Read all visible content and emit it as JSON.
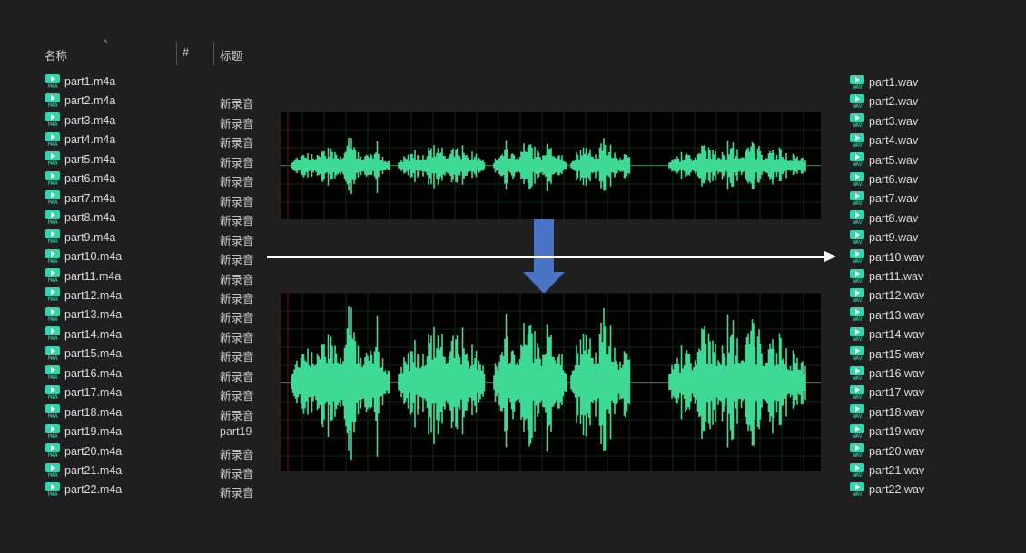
{
  "header": {
    "name_col": "名称",
    "num_col": "#",
    "title_col": "标题",
    "sort_glyph": "^"
  },
  "left_files": [
    {
      "name": "part1.m4a",
      "title": ""
    },
    {
      "name": "part2.m4a",
      "title": "新录音"
    },
    {
      "name": "part3.m4a",
      "title": "新录音"
    },
    {
      "name": "part4.m4a",
      "title": "新录音"
    },
    {
      "name": "part5.m4a",
      "title": "新录音"
    },
    {
      "name": "part6.m4a",
      "title": "新录音"
    },
    {
      "name": "part7.m4a",
      "title": "新录音"
    },
    {
      "name": "part8.m4a",
      "title": "新录音"
    },
    {
      "name": "part9.m4a",
      "title": "新录音"
    },
    {
      "name": "part10.m4a",
      "title": "新录音"
    },
    {
      "name": "part11.m4a",
      "title": "新录音"
    },
    {
      "name": "part12.m4a",
      "title": "新录音"
    },
    {
      "name": "part13.m4a",
      "title": "新录音"
    },
    {
      "name": "part14.m4a",
      "title": "新录音"
    },
    {
      "name": "part15.m4a",
      "title": "新录音"
    },
    {
      "name": "part16.m4a",
      "title": "新录音"
    },
    {
      "name": "part17.m4a",
      "title": "新录音"
    },
    {
      "name": "part18.m4a",
      "title": "新录音"
    },
    {
      "name": "part19.m4a",
      "title": "part19"
    },
    {
      "name": "part20.m4a",
      "title": "新录音"
    },
    {
      "name": "part21.m4a",
      "title": "新录音"
    },
    {
      "name": "part22.m4a",
      "title": "新录音"
    }
  ],
  "right_files": [
    "part1.wav",
    "part2.wav",
    "part3.wav",
    "part4.wav",
    "part5.wav",
    "part6.wav",
    "part7.wav",
    "part8.wav",
    "part9.wav",
    "part10.wav",
    "part11.wav",
    "part12.wav",
    "part13.wav",
    "part14.wav",
    "part15.wav",
    "part16.wav",
    "part17.wav",
    "part18.wav",
    "part19.wav",
    "part20.wav",
    "part21.wav",
    "part22.wav"
  ],
  "icons": {
    "left_file_icon": "m4a-audio-file-icon",
    "right_file_icon": "wav-audio-file-icon",
    "left_icon_text": "M4A",
    "right_icon_text": "WAV"
  },
  "colors": {
    "waveform": "#3fd996",
    "file_icon": "#2fd6ae",
    "down_arrow": "#4a73c6",
    "arrow": "#ffffff"
  }
}
